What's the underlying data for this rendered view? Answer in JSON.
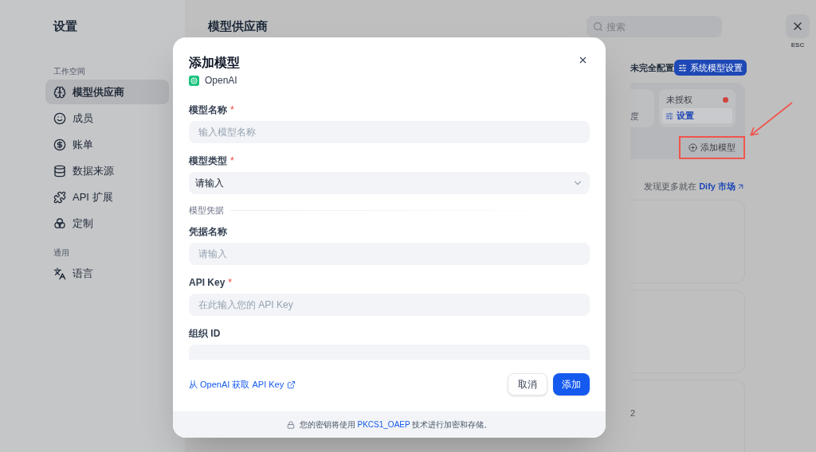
{
  "sidebar": {
    "title": "设置",
    "sections": [
      {
        "heading": "工作空间",
        "items": [
          {
            "label": "模型供应商",
            "selected": true
          },
          {
            "label": "成员",
            "selected": false
          },
          {
            "label": "账单",
            "selected": false
          },
          {
            "label": "数据来源",
            "selected": false
          },
          {
            "label": "API 扩展",
            "selected": false
          },
          {
            "label": "定制",
            "selected": false
          }
        ]
      },
      {
        "heading": "通用",
        "items": [
          {
            "label": "语言",
            "selected": false
          }
        ]
      }
    ]
  },
  "page": {
    "title": "模型供应商",
    "search": {
      "placeholder": "搜索"
    },
    "close_hint": "ESC"
  },
  "provider": {
    "status": "未完全配置",
    "system_button": "系统模型设置",
    "quota_fragment": "度",
    "auth_label": "未授权",
    "auth_button": "设置",
    "add_model": "添加模型"
  },
  "marketplace": {
    "text": "发现更多就在",
    "link": "Dify 市场"
  },
  "card_fragment": "2",
  "modal": {
    "title": "添加模型",
    "provider": "OpenAI",
    "required_mark": "*",
    "fields": [
      {
        "kind": "input",
        "label": "模型名称",
        "required": true,
        "placeholder": "输入模型名称"
      },
      {
        "kind": "select",
        "label": "模型类型",
        "required": true,
        "value": "请输入"
      },
      {
        "kind": "section",
        "label": "模型凭据"
      },
      {
        "kind": "input",
        "label": "凭据名称",
        "required": false,
        "placeholder": "请输入"
      },
      {
        "kind": "input",
        "label": "API Key",
        "required": true,
        "placeholder": "在此输入您的 API Key"
      },
      {
        "kind": "input",
        "label": "组织 ID",
        "required": false
      }
    ],
    "help_link": "从 OpenAI 获取 API Key",
    "cancel": "取消",
    "submit": "添加",
    "footer": {
      "before": "您的密钥将使用",
      "link": "PKCS1_OAEP",
      "after": "技术进行加密和存储。"
    }
  }
}
